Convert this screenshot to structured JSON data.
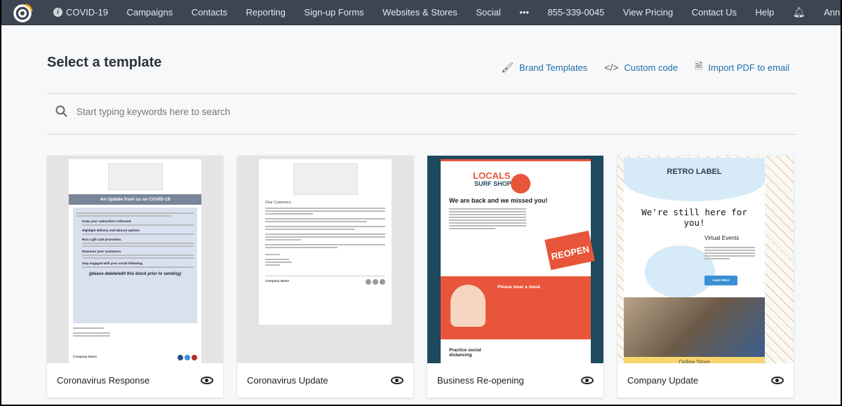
{
  "nav": {
    "items": [
      "COVID-19",
      "Campaigns",
      "Contacts",
      "Reporting",
      "Sign-up Forms",
      "Websites & Stores",
      "Social",
      "•••",
      "855-339-0045",
      "View Pricing",
      "Contact Us",
      "Help"
    ],
    "user": "Anna"
  },
  "page": {
    "title": "Select a template",
    "actions": [
      {
        "label": "Brand Templates",
        "icon": "brush-icon"
      },
      {
        "label": "Custom code",
        "icon": "code-icon"
      },
      {
        "label": "Import PDF to email",
        "icon": "pdf-icon"
      }
    ]
  },
  "search": {
    "placeholder": "Start typing keywords here to search"
  },
  "templates": [
    {
      "name": "Coronavirus Response",
      "header": "An Update from us on COVID-19",
      "bullets": [
        "Keep your subscribers informed.",
        "Highlight delivery and takeout options.",
        "Run a gift card promotion.",
        "Reassure your customers.",
        "Stay engaged with your social following."
      ],
      "note": "(please delete/edit this block prior to sending)",
      "company": "Company Name"
    },
    {
      "name": "Coronavirus Update",
      "greeting": "Dear Customers,",
      "company": "Company Name"
    },
    {
      "name": "Business Re-opening",
      "brand": [
        "LOCALS",
        "SURF SHOP"
      ],
      "headline": "We are back and we missed you!",
      "sign": "REOPEN",
      "mask": "Please wear a mask",
      "distancing": "Practice social distancing"
    },
    {
      "name": "Company Update",
      "brand": "RETRO LABEL",
      "headline": "We're still here for you!",
      "events": "Virtual Events",
      "button": "Learn More",
      "store": "Online Store"
    }
  ],
  "colors": {
    "nav": "#3d4552",
    "link": "#1d6ea8",
    "surf_dark": "#1f4a5e",
    "surf_orange": "#e8553a",
    "retro_blue": "#d6eaf8"
  }
}
